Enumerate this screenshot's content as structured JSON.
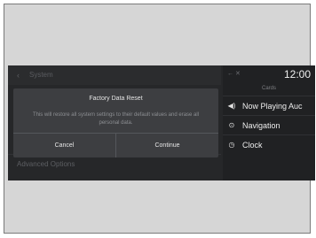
{
  "system": {
    "header_title": "System",
    "back_icon": "chevron-left-icon",
    "row_label": "Advanced Options"
  },
  "dialog": {
    "title": "Factory Data Reset",
    "message": "This will restore all system settings to their default values and erase all personal data.",
    "cancel_label": "Cancel",
    "continue_label": "Continue"
  },
  "cards_panel": {
    "clock": "12:00",
    "status_icons": "← ✕",
    "title": "Cards",
    "items": [
      {
        "label": "Now Playing Auc",
        "icon": "speaker-icon",
        "glyph": "◀)"
      },
      {
        "label": "Navigation",
        "icon": "navigation-pin-icon",
        "glyph": "⊙"
      },
      {
        "label": "Clock",
        "icon": "clock-icon",
        "glyph": "◷"
      }
    ]
  },
  "colors": {
    "screen_bg": "#262729",
    "dialog_bg": "#3d3e41",
    "cards_bg": "#202123"
  }
}
